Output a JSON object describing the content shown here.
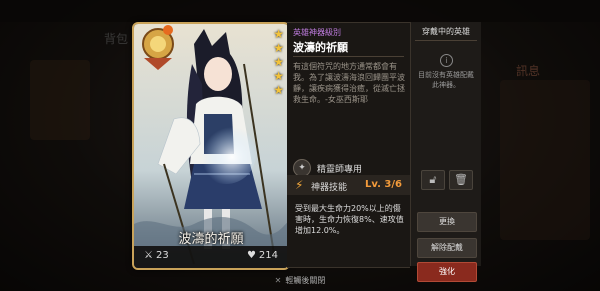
{
  "background": {
    "bag_label": "背包",
    "right_label": "訊息"
  },
  "card": {
    "name": "波濤的祈願",
    "attack": "23",
    "health": "214",
    "star_count": 5,
    "emblem_icon": "sun-emblem-icon",
    "colors": {
      "frame": "#c9a35a",
      "star": "#f3c33b"
    }
  },
  "info": {
    "tag": "英雄神器級別",
    "title": "波濤的祈願",
    "description": "有這個符咒的地方通常都會有我。為了讓波濤海浪回歸團平波靜，讓疾病獲得治癒，從滅亡拯救生命。-女巫西斯耶",
    "exclusive_label": "精靈師專用",
    "skill_label": "神器技能",
    "skill_level": "Lv. 3/6",
    "skill_description": "受到最大生命力20%以上的傷害時，生命力恢復8%、速攻值增加12.0%。",
    "colors": {
      "tag": "#c07de0",
      "level": "#f39b3b"
    }
  },
  "wearing": {
    "title": "穿戴中的英雄",
    "empty_text": "目前沒有英雄配戴此神器。",
    "buttons": {
      "change": "更換",
      "unequip": "解除配戴",
      "enhance": "強化"
    }
  },
  "footer": {
    "close_text": "輕觸後關閉"
  }
}
